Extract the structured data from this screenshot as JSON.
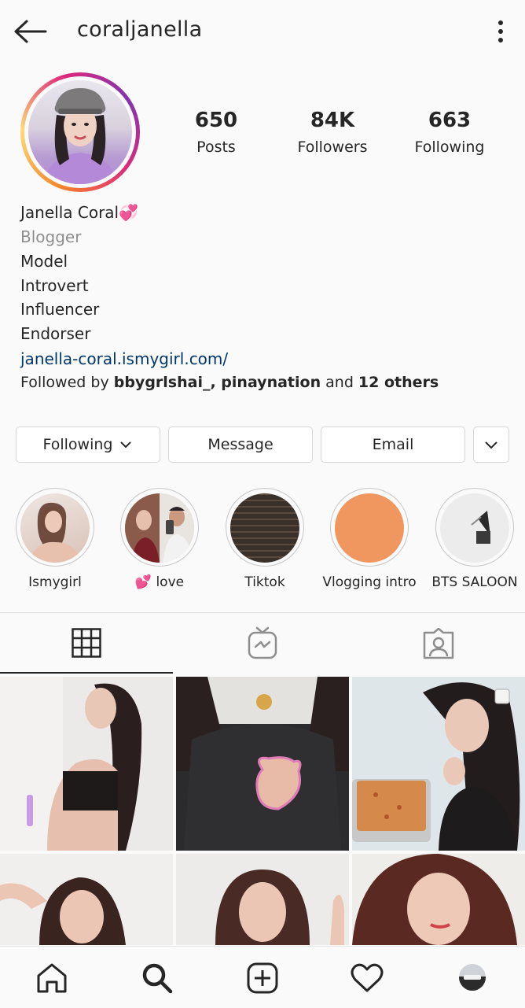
{
  "header": {
    "username": "coraljanella"
  },
  "stats": [
    {
      "value": "650",
      "label": "Posts"
    },
    {
      "value": "84K",
      "label": "Followers"
    },
    {
      "value": "663",
      "label": "Following"
    }
  ],
  "bio": {
    "name": "Janella Coral💞",
    "category": "Blogger",
    "lines": [
      "Model",
      "Introvert",
      "Influencer",
      "Endorser"
    ],
    "link": "janella-coral.ismygirl.com/",
    "followed_by_prefix": "Followed by ",
    "followed_by_users": "bbygrlshai_, pinaynation",
    "followed_by_and": " and ",
    "followed_by_others": "12 others"
  },
  "actions": {
    "following_label": "Following",
    "message_label": "Message",
    "email_label": "Email"
  },
  "highlights": [
    {
      "label": "Ismygirl"
    },
    {
      "label": "💕 love"
    },
    {
      "label": "Tiktok"
    },
    {
      "label": "Vlogging intro"
    },
    {
      "label": "BTS SALOON"
    }
  ],
  "tabs": [
    {
      "icon": "grid-icon",
      "active": true
    },
    {
      "icon": "igtv-icon",
      "active": false
    },
    {
      "icon": "tagged-icon",
      "active": false
    }
  ],
  "bottom_nav": [
    {
      "icon": "home-icon"
    },
    {
      "icon": "search-icon",
      "active": true
    },
    {
      "icon": "new-post-icon"
    },
    {
      "icon": "activity-heart-icon"
    },
    {
      "icon": "profile-avatar-icon"
    }
  ],
  "colors": {
    "link": "#00376b",
    "secondary_text": "#8e8e8e",
    "border": "#d6d6d6",
    "highlight_vlogging": "#f0965f"
  }
}
